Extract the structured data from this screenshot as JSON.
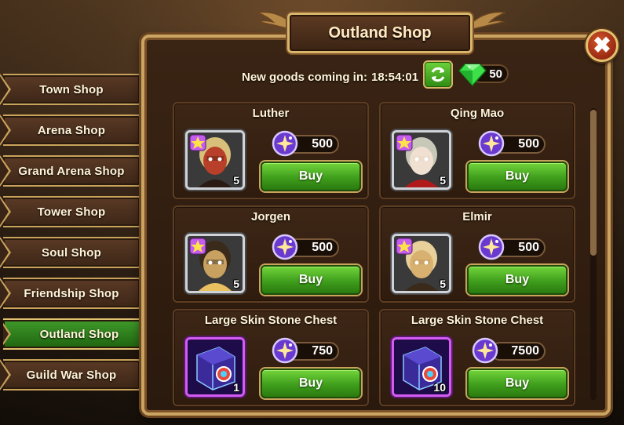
{
  "shop": {
    "title": "Outland Shop",
    "timer_label": "New goods coming in:",
    "timer_value": "18:54:01",
    "gems": "50",
    "close_glyph": "✖"
  },
  "tabs": [
    {
      "label": "Town Shop",
      "active": false
    },
    {
      "label": "Arena Shop",
      "active": false
    },
    {
      "label": "Grand Arena Shop",
      "active": false
    },
    {
      "label": "Tower Shop",
      "active": false
    },
    {
      "label": "Soul Shop",
      "active": false
    },
    {
      "label": "Friendship Shop",
      "active": false
    },
    {
      "label": "Outland Shop",
      "active": true
    },
    {
      "label": "Guild War Shop",
      "active": false
    }
  ],
  "items": [
    {
      "name": "Luther",
      "price": "500",
      "qty": "5",
      "buy": "Buy",
      "kind": "hero"
    },
    {
      "name": "Qing Mao",
      "price": "500",
      "qty": "5",
      "buy": "Buy",
      "kind": "hero"
    },
    {
      "name": "Jorgen",
      "price": "500",
      "qty": "5",
      "buy": "Buy",
      "kind": "hero"
    },
    {
      "name": "Elmir",
      "price": "500",
      "qty": "5",
      "buy": "Buy",
      "kind": "hero"
    },
    {
      "name": "Large Skin Stone Chest",
      "price": "750",
      "qty": "1",
      "buy": "Buy",
      "kind": "chest"
    },
    {
      "name": "Large Skin Stone Chest",
      "price": "7500",
      "qty": "10",
      "buy": "Buy",
      "kind": "chest"
    }
  ],
  "colors": {
    "accent_gold": "#caa460",
    "buy_green": "#3f9e1c",
    "currency_purple": "#7a3ad0"
  }
}
